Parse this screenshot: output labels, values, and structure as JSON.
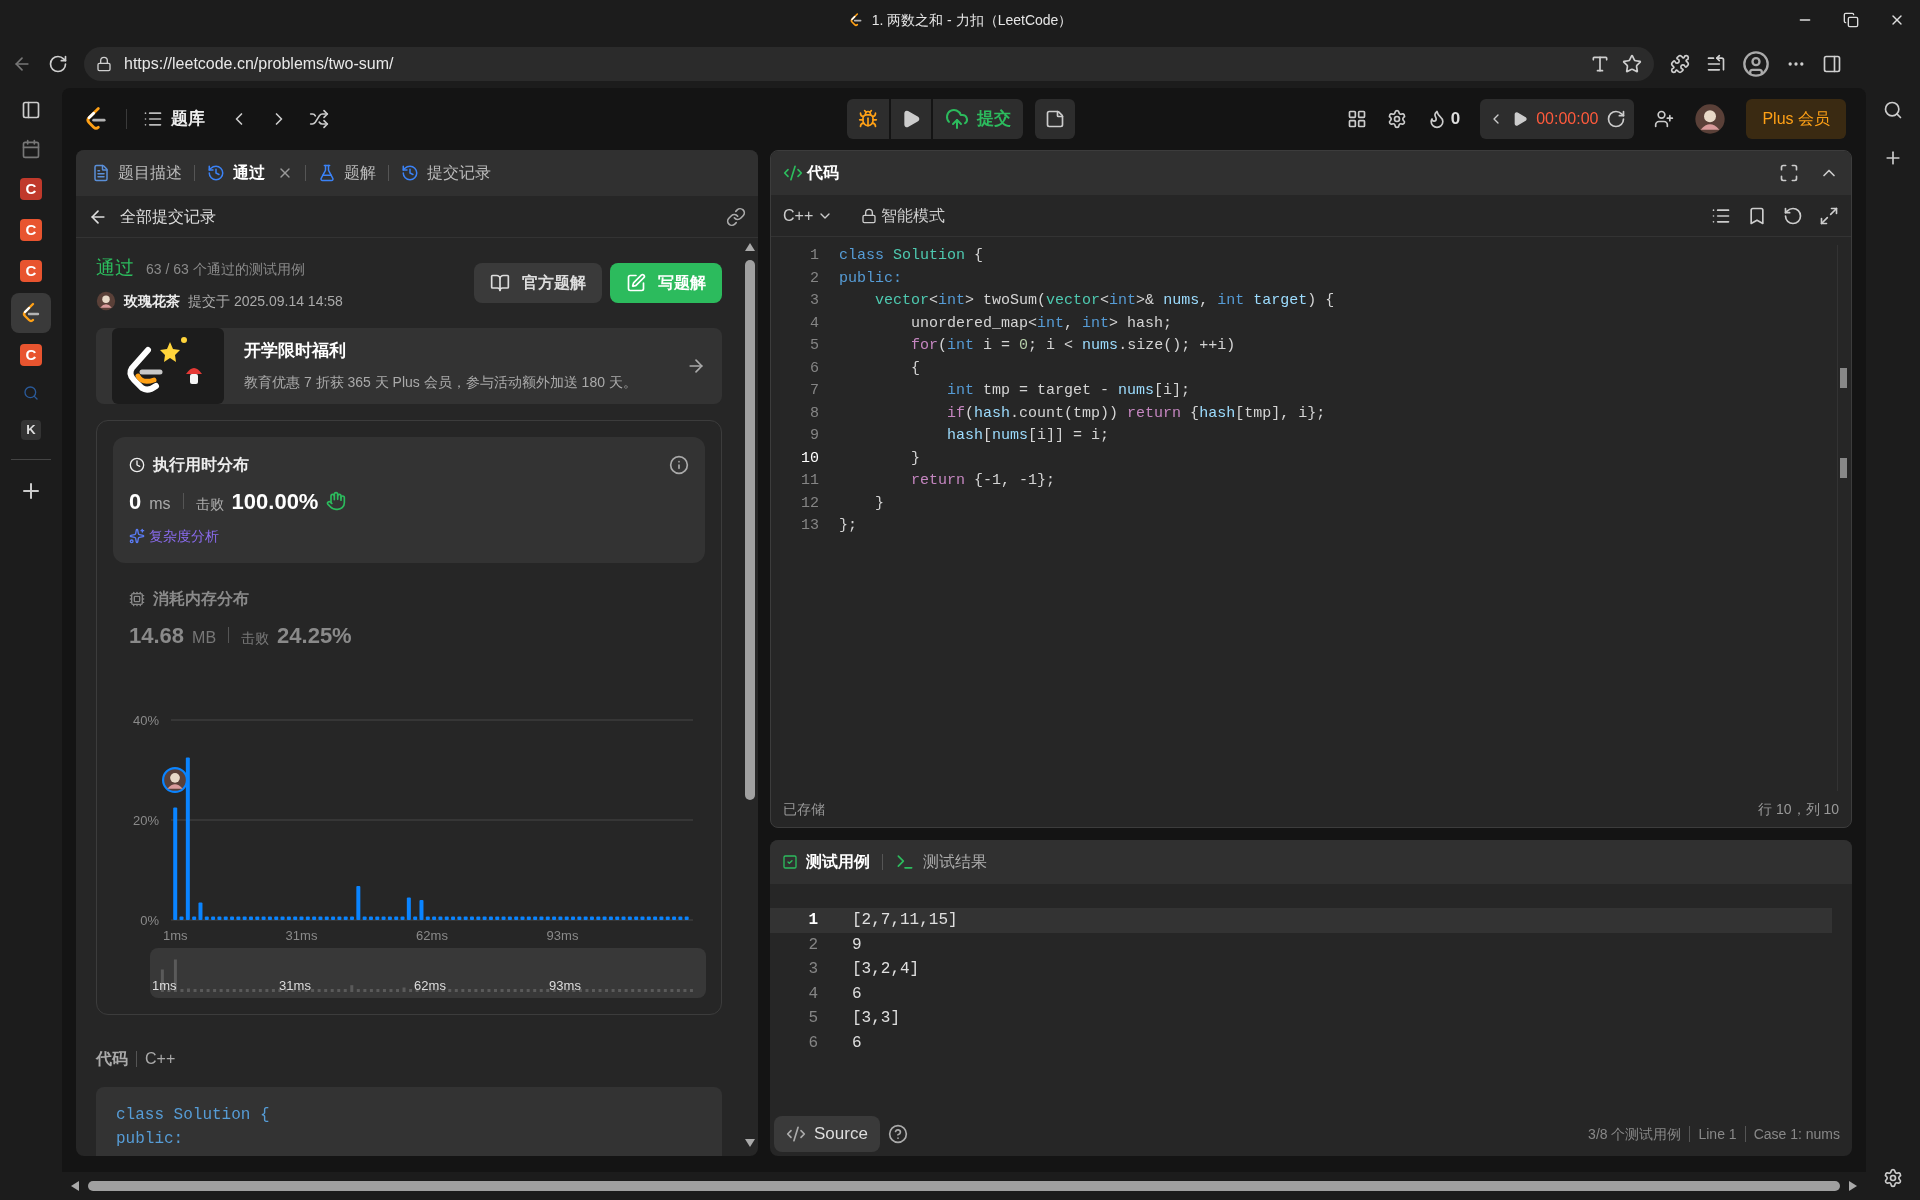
{
  "browser": {
    "tab_title": "1. 两数之和 - 力扣（LeetCode）",
    "url": "https://leetcode.cn/problems/two-sum/"
  },
  "browser_sidebar": {
    "apps": [
      {
        "label": "C",
        "color": "#c0392b"
      },
      {
        "label": "C",
        "color": "#e8542f"
      },
      {
        "label": "C",
        "color": "#e8542f"
      },
      {
        "label": "C",
        "color": "#e8542f"
      }
    ],
    "k_app": "K"
  },
  "nav": {
    "problem_list": "题库",
    "submit": "提交",
    "streak": "0",
    "timer": "00:00:00",
    "plus": "Plus 会员"
  },
  "left_tabs": [
    {
      "label": "题目描述",
      "selected": false,
      "closable": false
    },
    {
      "label": "通过",
      "selected": true,
      "closable": true
    },
    {
      "label": "题解",
      "selected": false,
      "closable": false
    },
    {
      "label": "提交记录",
      "selected": false,
      "closable": false
    }
  ],
  "back_link": "全部提交记录",
  "submission": {
    "status": "通过",
    "cases": "63 / 63 个通过的测试用例",
    "user": "玫瑰花茶",
    "submitted": "提交于 2025.09.14 14:58",
    "official_button": "官方题解",
    "write_button": "写题解"
  },
  "promo": {
    "title": "开学限时福利",
    "text": "教育优惠 7 折获 365 天 Plus 会员，参与活动额外加送 180 天。"
  },
  "runtime": {
    "title": "执行用时分布",
    "value": "0",
    "unit": "ms",
    "beat_label": "击败",
    "beat": "100.00%",
    "analysis": "复杂度分析",
    "selected": true
  },
  "memory": {
    "title": "消耗内存分布",
    "value": "14.68",
    "unit": "MB",
    "beat_label": "击败",
    "beat": "24.25%",
    "selected": false
  },
  "chart_data": {
    "type": "bar",
    "xlim": [
      0,
      124
    ],
    "ylim": [
      0,
      40
    ],
    "xticks": [
      {
        "value": 1,
        "label": "1ms"
      },
      {
        "value": 31,
        "label": "31ms"
      },
      {
        "value": 62,
        "label": "62ms"
      },
      {
        "value": 93,
        "label": "93ms"
      }
    ],
    "yticks": [
      {
        "value": 0,
        "label": "0%"
      },
      {
        "value": 20,
        "label": "20%"
      },
      {
        "value": 40,
        "label": "40%"
      }
    ],
    "x": [
      1,
      2.5,
      4,
      5.5,
      7,
      8.5,
      10,
      11.5,
      13,
      14.5,
      16,
      17.5,
      19,
      20.5,
      22,
      23.5,
      25,
      26.5,
      28,
      29.5,
      31,
      32.5,
      34,
      35.5,
      37,
      38.5,
      40,
      41.5,
      43,
      44.5,
      46,
      47.5,
      49,
      50.5,
      52,
      53.5,
      55,
      56.5,
      58,
      59.5,
      61,
      62.5,
      64,
      65.5,
      67,
      68.5,
      70,
      71.5,
      73,
      74.5,
      76,
      77.5,
      79,
      80.5,
      82,
      83.5,
      85,
      86.5,
      88,
      89.5,
      91,
      92.5,
      94,
      95.5,
      97,
      98.5,
      100,
      101.5,
      103,
      104.5,
      106,
      107.5,
      109,
      110.5,
      112,
      113.5,
      115,
      116.5,
      118,
      119.5,
      121,
      122.5
    ],
    "series": [
      {
        "color": "#0a84ff",
        "values": [
          22.5,
          0.7,
          32.5,
          0.7,
          3.5,
          0.7,
          0.7,
          0.7,
          0.7,
          0.7,
          0.7,
          0.7,
          0.7,
          0.7,
          0.7,
          0.7,
          0.7,
          0.7,
          0.7,
          0.7,
          0.7,
          0.7,
          0.7,
          0.7,
          0.7,
          0.7,
          0.7,
          0.7,
          0.7,
          6.8,
          0.7,
          0.7,
          0.7,
          0.7,
          0.7,
          0.7,
          0.7,
          4.5,
          0.7,
          4.0,
          0.7,
          0.7,
          0.7,
          0.7,
          0.7,
          0.7,
          0.7,
          0.7,
          0.7,
          0.7,
          0.7,
          0.7,
          0.7,
          0.7,
          0.7,
          0.7,
          0.7,
          0.7,
          0.7,
          0.7,
          0.7,
          0.7,
          0.7,
          0.7,
          0.7,
          0.7,
          0.7,
          0.7,
          0.7,
          0.7,
          0.7,
          0.7,
          0.7,
          0.7,
          0.7,
          0.7,
          0.7,
          0.7,
          0.7,
          0.7,
          0.7,
          0.7
        ]
      }
    ]
  },
  "navigator_labels": [
    "1ms",
    "31ms",
    "62ms",
    "93ms"
  ],
  "code_preview": {
    "title": "代码",
    "language": "C++",
    "lines": [
      "class Solution {",
      "public:"
    ]
  },
  "editor": {
    "title": "代码",
    "language": "C++",
    "mode": "智能模式",
    "lines": [
      {
        "n": "1",
        "current": false,
        "tokens": [
          {
            "text": "class",
            "kind": "keyword"
          },
          {
            "text": " Solution",
            "kind": "type"
          },
          {
            "text": " {",
            "kind": "plain"
          }
        ]
      },
      {
        "n": "2",
        "current": false,
        "tokens": [
          {
            "text": "public:",
            "kind": "keyword"
          }
        ]
      },
      {
        "n": "3",
        "current": false,
        "tokens": [
          {
            "text": "    vector",
            "kind": "type"
          },
          {
            "text": "<",
            "kind": "plain"
          },
          {
            "text": "int",
            "kind": "keyword"
          },
          {
            "text": "> twoSum(",
            "kind": "plain"
          },
          {
            "text": "vector",
            "kind": "type"
          },
          {
            "text": "<",
            "kind": "plain"
          },
          {
            "text": "int",
            "kind": "keyword"
          },
          {
            "text": ">& ",
            "kind": "plain"
          },
          {
            "text": "nums",
            "kind": "variable"
          },
          {
            "text": ", ",
            "kind": "plain"
          },
          {
            "text": "int",
            "kind": "keyword"
          },
          {
            "text": " target",
            "kind": "variable"
          },
          {
            "text": ") {",
            "kind": "plain"
          }
        ]
      },
      {
        "n": "4",
        "current": false,
        "tokens": [
          {
            "text": "        unordered_map<",
            "kind": "plain"
          },
          {
            "text": "int",
            "kind": "keyword"
          },
          {
            "text": ", ",
            "kind": "plain"
          },
          {
            "text": "int",
            "kind": "keyword"
          },
          {
            "text": "> hash;",
            "kind": "plain"
          }
        ]
      },
      {
        "n": "5",
        "current": false,
        "tokens": [
          {
            "text": "        for",
            "kind": "control"
          },
          {
            "text": "(",
            "kind": "plain"
          },
          {
            "text": "int",
            "kind": "keyword"
          },
          {
            "text": " i = ",
            "kind": "plain"
          },
          {
            "text": "0",
            "kind": "number"
          },
          {
            "text": "; i < ",
            "kind": "plain"
          },
          {
            "text": "nums",
            "kind": "variable"
          },
          {
            "text": ".size(); ++i)",
            "kind": "plain"
          }
        ]
      },
      {
        "n": "6",
        "current": false,
        "tokens": [
          {
            "text": "        {",
            "kind": "plain"
          }
        ]
      },
      {
        "n": "7",
        "current": false,
        "tokens": [
          {
            "text": "            int",
            "kind": "keyword"
          },
          {
            "text": " tmp = target - ",
            "kind": "plain"
          },
          {
            "text": "nums",
            "kind": "variable"
          },
          {
            "text": "[i];",
            "kind": "plain"
          }
        ]
      },
      {
        "n": "8",
        "current": false,
        "tokens": [
          {
            "text": "            if",
            "kind": "control"
          },
          {
            "text": "(",
            "kind": "plain"
          },
          {
            "text": "hash",
            "kind": "variable"
          },
          {
            "text": ".count(tmp)) ",
            "kind": "plain"
          },
          {
            "text": "return",
            "kind": "control"
          },
          {
            "text": " {",
            "kind": "plain"
          },
          {
            "text": "hash",
            "kind": "variable"
          },
          {
            "text": "[tmp], i};",
            "kind": "plain"
          }
        ]
      },
      {
        "n": "9",
        "current": false,
        "tokens": [
          {
            "text": "            hash",
            "kind": "variable"
          },
          {
            "text": "[",
            "kind": "plain"
          },
          {
            "text": "nums",
            "kind": "variable"
          },
          {
            "text": "[i]] = i;",
            "kind": "plain"
          }
        ]
      },
      {
        "n": "10",
        "current": true,
        "tokens": [
          {
            "text": "        }",
            "kind": "plain"
          }
        ]
      },
      {
        "n": "11",
        "current": false,
        "tokens": [
          {
            "text": "        return",
            "kind": "control"
          },
          {
            "text": " {-1, -1};",
            "kind": "plain"
          }
        ]
      },
      {
        "n": "12",
        "current": false,
        "tokens": [
          {
            "text": "    }",
            "kind": "plain"
          }
        ]
      },
      {
        "n": "13",
        "current": false,
        "tokens": [
          {
            "text": "};",
            "kind": "plain"
          }
        ]
      }
    ]
  },
  "editor_status": {
    "saved": "已存储",
    "cursor": "行 10，列 10"
  },
  "test_tabs": [
    {
      "label": "测试用例",
      "selected": true
    },
    {
      "label": "测试结果",
      "selected": false
    }
  ],
  "test_lines": [
    {
      "n": "1",
      "text": "[2,7,11,15]",
      "current": true
    },
    {
      "n": "2",
      "text": "9",
      "current": false
    },
    {
      "n": "3",
      "text": "[3,2,4]",
      "current": false
    },
    {
      "n": "4",
      "text": "6",
      "current": false
    },
    {
      "n": "5",
      "text": "[3,3]",
      "current": false
    },
    {
      "n": "6",
      "text": "6",
      "current": false
    }
  ],
  "test_footer": {
    "source": "Source",
    "count": "3/8 个测试用例",
    "line": "Line 1",
    "case": "Case 1: nums"
  }
}
